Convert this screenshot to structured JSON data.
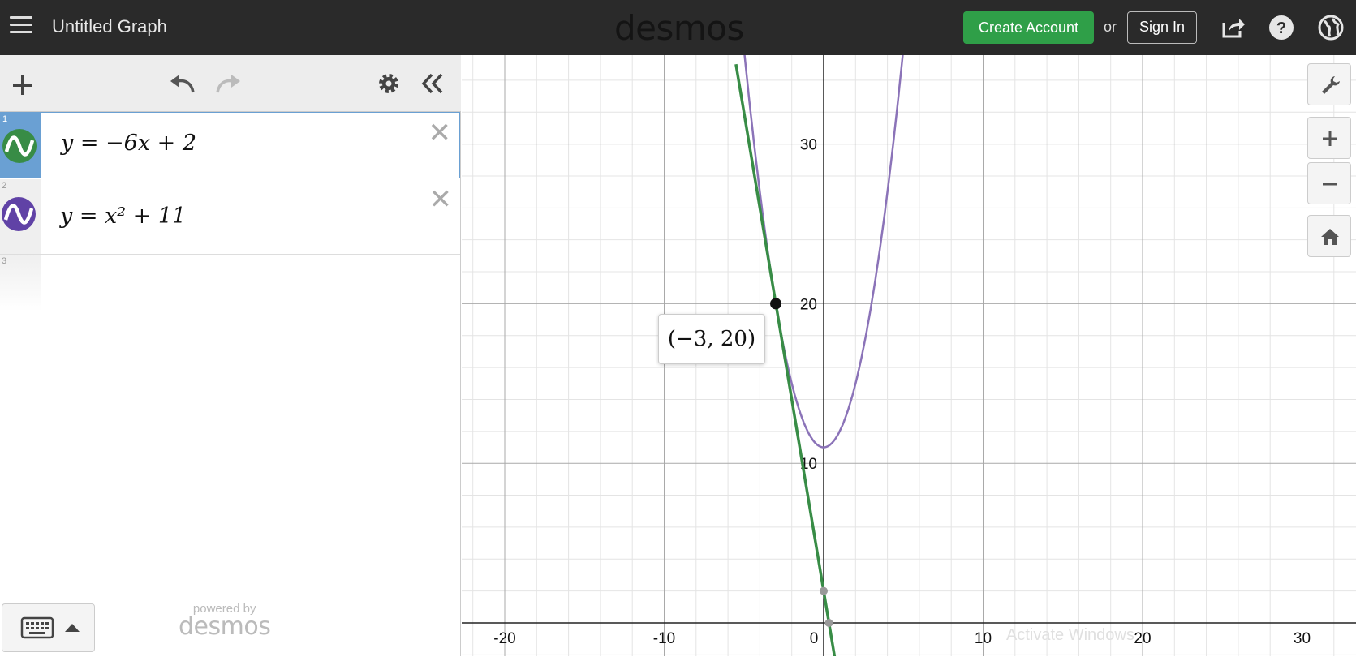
{
  "header": {
    "title": "Untitled Graph",
    "logo": "desmos",
    "create_account": "Create Account",
    "or": "or",
    "sign_in": "Sign In",
    "icons": [
      "menu-icon",
      "share-icon",
      "help-icon",
      "globe-icon"
    ]
  },
  "toolbar": {
    "icons": [
      "add-icon",
      "undo-icon",
      "redo-icon",
      "settings-icon",
      "collapse-icon"
    ]
  },
  "expressions": [
    {
      "num": "1",
      "latex": "y = −6x + 2",
      "color": "#388c46",
      "active": true
    },
    {
      "num": "2",
      "latex": "y = x² + 11",
      "color": "#6042a6",
      "active": false
    },
    {
      "num": "3",
      "latex": "",
      "color": "",
      "active": false
    }
  ],
  "keyboard": {
    "icon": "keyboard-icon"
  },
  "powered_by": {
    "label": "powered by",
    "logo": "desmos"
  },
  "graph": {
    "x_ticks": [
      "-20",
      "-10",
      "0",
      "10",
      "20",
      "30"
    ],
    "y_ticks": [
      "10",
      "20",
      "30"
    ],
    "point_label": "(−3, 20)",
    "line_color": "#388c46",
    "parabola_color": "#8b73b8",
    "watermark": "Activate Windows"
  },
  "side_controls": {
    "icons": [
      "wrench-icon",
      "zoom-in-icon",
      "zoom-out-icon",
      "home-icon"
    ]
  },
  "chart_data": {
    "type": "line",
    "series": [
      {
        "expression": "y = -6x + 2",
        "slope": -6,
        "intercept": 2
      },
      {
        "expression": "y = x^2 + 11",
        "a": 1,
        "c": 11
      }
    ],
    "point": {
      "x": -3,
      "y": 20
    },
    "xlim": [
      -23,
      33
    ],
    "ylim": [
      -2,
      36
    ],
    "grid": true
  }
}
